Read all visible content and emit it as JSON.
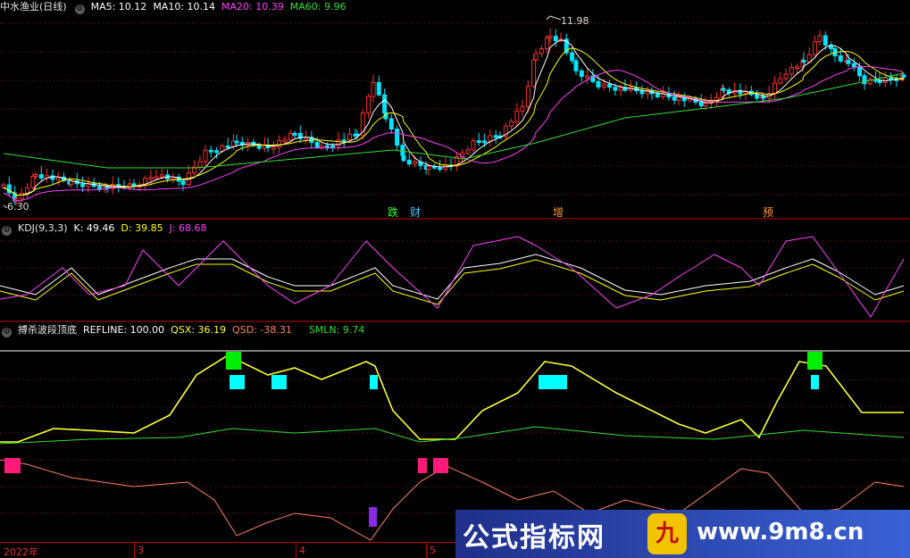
{
  "main_panel": {
    "title": "中水渔业(日线)",
    "ma5": "MA5: 10.12",
    "ma10": "MA10: 10.14",
    "ma20": "MA20: 10.39",
    "ma60": "MA60: 9.96",
    "high_label": "11.98",
    "low_label": "6.30",
    "events": [
      "跌",
      "财",
      "增",
      "预"
    ]
  },
  "kdj_panel": {
    "title": "KDJ(9,3,3)",
    "k": "K: 49.46",
    "d": "D: 39.85",
    "j": "J: 68.68"
  },
  "custom_panel": {
    "title": "搏杀波段顶底",
    "refline": "REFLINE: 100.00",
    "qsx": "QSX: 36.19",
    "qsd": "QSD: -38.31",
    "smln": "SMLN: 9.74"
  },
  "time_axis": {
    "labels": [
      "2022年",
      "3",
      "4",
      "5"
    ]
  },
  "watermark": {
    "brand": "公式指标网",
    "badge": "九",
    "url": "www.9m8.cn"
  },
  "colors": {
    "up": "#ff3030",
    "down": "#00e5ff",
    "ma5": "#ffffff",
    "ma10": "#ffff00",
    "ma20": "#ff40ff",
    "ma60": "#30e030",
    "qsx": "#ffff33",
    "qsd": "#ff8060",
    "smln": "#33dd33",
    "marker_green": "#00ee00",
    "marker_cyan": "#00ffff",
    "marker_pink": "#ff1a7a",
    "marker_purple": "#8a2be2"
  }
}
